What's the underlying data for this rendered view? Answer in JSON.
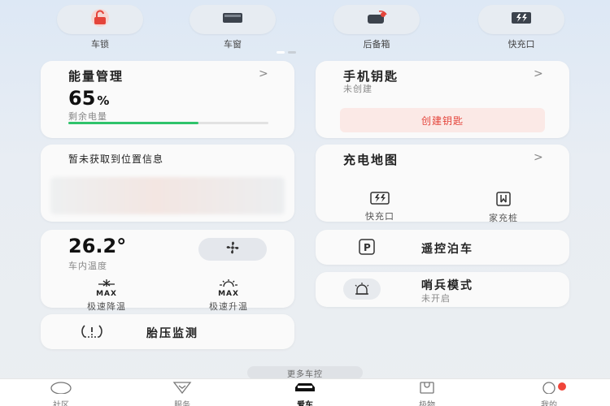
{
  "quick_actions": [
    {
      "label": "车锁",
      "icon": "unlock-icon"
    },
    {
      "label": "车窗",
      "icon": "window-icon"
    },
    {
      "label": "后备箱",
      "icon": "trunk-icon"
    },
    {
      "label": "快充口",
      "icon": "fast-charge-port-icon"
    }
  ],
  "energy": {
    "title": "能量管理",
    "value": "65",
    "unit": "%",
    "label": "剩余电量",
    "level": 0.65,
    "chevron": ">"
  },
  "phone_key": {
    "title": "手机钥匙",
    "status": "未创建",
    "button": "创建钥匙",
    "chevron": ">"
  },
  "location": {
    "title": "暂未获取到位置信息"
  },
  "charge_map": {
    "title": "充电地图",
    "chevron": ">",
    "items": [
      {
        "label": "快充口",
        "icon": "fast-charge-icon"
      },
      {
        "label": "家充桩",
        "icon": "home-charger-icon"
      }
    ]
  },
  "climate": {
    "temperature": "26.2°",
    "label": "车内温度",
    "fast_cool": "极速降温",
    "fast_heat": "极速升温",
    "max": "MAX"
  },
  "remote_parking": {
    "title": "遥控泊车"
  },
  "sentry": {
    "title": "哨兵模式",
    "status": "未开启"
  },
  "tire": {
    "title": "胎压监测"
  },
  "more_controls": "更多车控",
  "tabs": [
    {
      "label": "社区",
      "icon": "community-icon"
    },
    {
      "label": "服务",
      "icon": "service-icon"
    },
    {
      "label": "爱车",
      "icon": "car-icon",
      "active": true
    },
    {
      "label": "极物",
      "icon": "shop-icon"
    },
    {
      "label": "我的",
      "icon": "profile-icon"
    }
  ],
  "colors": {
    "accent_red": "#e4443b",
    "battery_green": "#2fc36b"
  }
}
